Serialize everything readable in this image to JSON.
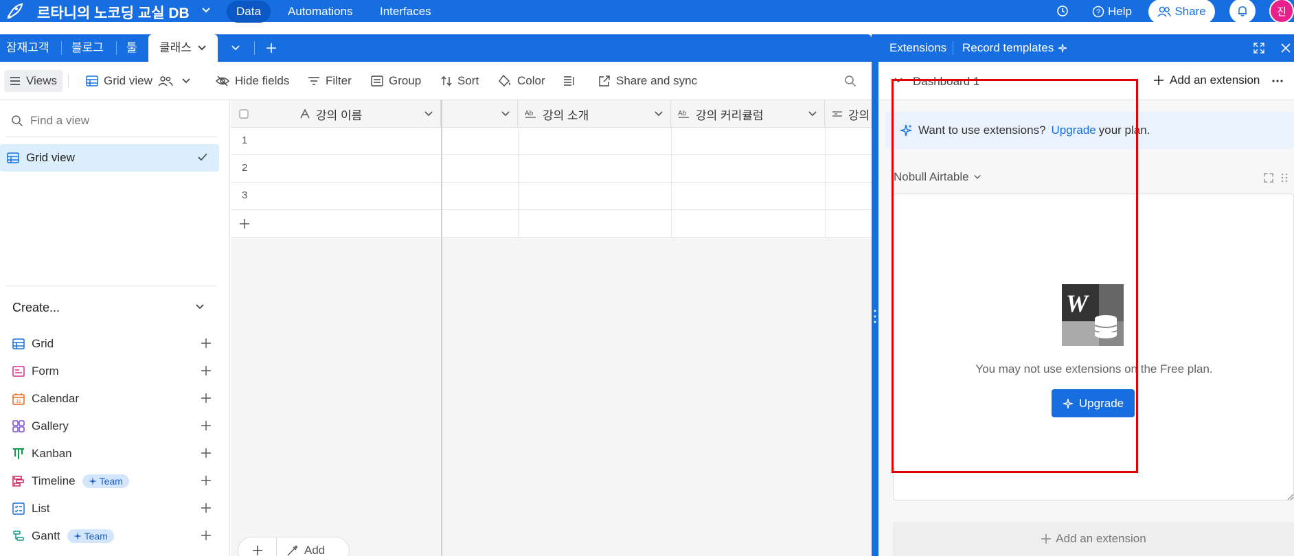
{
  "app": {
    "title": "르타니의 노코딩 교실 DB",
    "nav": [
      "Data",
      "Automations",
      "Interfaces"
    ],
    "help_label": "Help",
    "share_label": "Share",
    "avatar_initial": "진",
    "brand_color": "#166ee1"
  },
  "tabs": {
    "items": [
      "잠재고객",
      "블로그",
      "툴"
    ],
    "active": "클래스"
  },
  "toolbar": {
    "views_label": "Views",
    "view_name": "Grid view",
    "hide_fields": "Hide fields",
    "filter": "Filter",
    "group": "Group",
    "sort": "Sort",
    "color": "Color",
    "share_sync": "Share and sync"
  },
  "sidebar": {
    "find_placeholder": "Find a view",
    "active_view": "Grid view",
    "create_label": "Create...",
    "create_items": [
      "Grid",
      "Form",
      "Calendar",
      "Gallery",
      "Kanban",
      "Timeline",
      "List",
      "Gantt"
    ],
    "team_badge": "Team"
  },
  "grid": {
    "columns": [
      "강의 이름",
      "강의 소개",
      "강의 커리큘럼",
      "강의"
    ],
    "rows": [
      "1",
      "2",
      "3"
    ],
    "add_label": "Add"
  },
  "extensions_panel": {
    "tab_extensions": "Extensions",
    "tab_record_templates": "Record templates",
    "dashboard_name": "Dashboard 1",
    "add_extension": "Add an extension",
    "banner_pre": "Want to use extensions?",
    "banner_link": "Upgrade",
    "banner_post": "your plan.",
    "extension_name": "Nobull Airtable",
    "message": "You may not use extensions on the Free plan.",
    "upgrade_button": "Upgrade",
    "add_extension_bottom": "Add an extension"
  }
}
